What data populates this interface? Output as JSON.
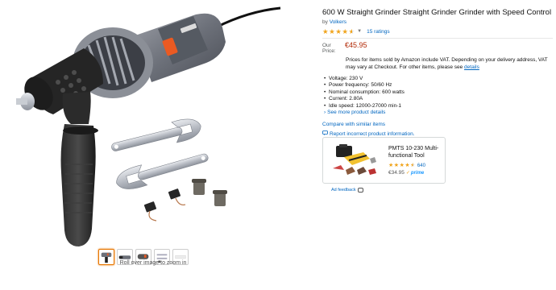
{
  "product": {
    "title": "600 W Straight Grinder Straight Grinder Grinder with Speed Control",
    "by_prefix": "by",
    "brand": "Volkers",
    "rating": 4.5,
    "ratings_count": "15 ratings",
    "price_label": "Our Price:",
    "price": "€45.95",
    "vat_text": "Prices for items sold by Amazon include VAT. Depending on your delivery address, VAT may vary at Checkout. For other items, please see",
    "vat_link": "details",
    "bullets": [
      "Voltage: 230 V",
      "Power frequency: 50/60 Hz",
      "Nominal consumption: 600 watts",
      "Current: 2.80A",
      "Idle speed: 12000-27000 min-1"
    ],
    "see_more": "See more product details",
    "compare": "Compare with similar items",
    "report": "Report incorrect product information."
  },
  "gallery": {
    "zoom_hint": "Roll over image to zoom in",
    "thumbnail_count": 5,
    "active_index": 0
  },
  "ad": {
    "title": "PMTS 10-230 Multi-functional Tool",
    "rating": 4.5,
    "count": "640",
    "price": "€34.95",
    "prime_label": "prime",
    "feedback": "Ad feedback"
  },
  "colors": {
    "link": "#0066c0",
    "price": "#b12704",
    "star": "#f0a41c",
    "thumb_active_border": "#e77600"
  },
  "icons": {
    "caret": "chevron-down-icon",
    "compare": "compare-icon",
    "report": "comment-icon",
    "feedback": "feedback-icon"
  }
}
